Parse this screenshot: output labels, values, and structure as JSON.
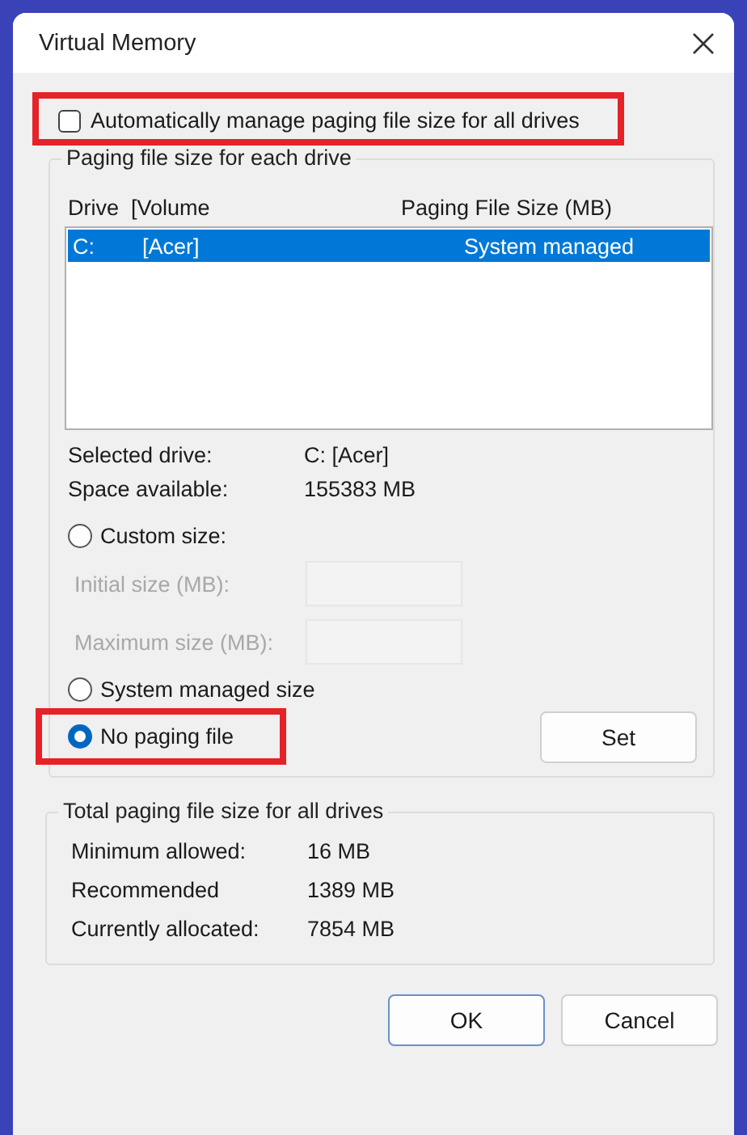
{
  "window": {
    "title": "Virtual Memory"
  },
  "auto_manage": {
    "label": "Automatically manage paging file size for all drives",
    "checked": false,
    "highlighted": true
  },
  "drives_group": {
    "title": "Paging file size for each drive",
    "columns": [
      "Drive  [Volume",
      "Paging File Size (MB)"
    ],
    "rows": [
      {
        "drive": "C:",
        "volume": "[Acer]",
        "size": "System managed",
        "selected": true
      }
    ],
    "info": [
      {
        "label": "Selected drive:",
        "value": "C:  [Acer]"
      },
      {
        "label": "Space available:",
        "value": "155383 MB"
      }
    ],
    "size_options": [
      {
        "kind": "radio",
        "label": "Custom size:",
        "selected": false,
        "highlighted": false
      },
      {
        "kind": "field",
        "label": "Initial size (MB):",
        "disabled": true
      },
      {
        "kind": "field",
        "label": "Maximum size (MB):",
        "disabled": true
      },
      {
        "kind": "radio",
        "label": "System managed size",
        "selected": false,
        "highlighted": false
      },
      {
        "kind": "radio",
        "label": "No paging file",
        "selected": true,
        "highlighted": true
      }
    ],
    "set_button": "Set"
  },
  "totals": {
    "title": "Total paging file size for all drives",
    "rows": [
      {
        "label": "Minimum allowed:",
        "value": "16 MB"
      },
      {
        "label": "Recommended",
        "value": "1389 MB"
      },
      {
        "label": "Currently allocated:",
        "value": "7854 MB"
      }
    ]
  },
  "buttons": [
    "OK",
    "Cancel"
  ]
}
